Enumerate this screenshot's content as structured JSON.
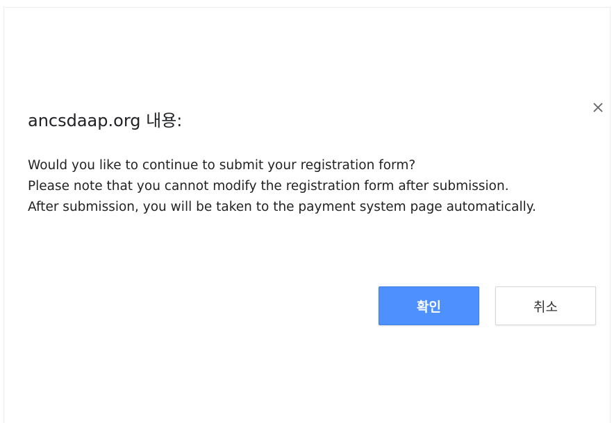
{
  "dialog": {
    "title": "ancsdaap.org 내용:",
    "message_lines": [
      "Would you like to continue to submit your registration form?",
      "Please note that you cannot modify the registration form after submission.",
      "After submission, you will be taken to the payment system page automatically."
    ],
    "ok_label": "확인",
    "cancel_label": "취소",
    "close_icon": "close-icon"
  },
  "colors": {
    "ok_button": "#4d90fe",
    "ok_text": "#ffffff",
    "cancel_border": "#d6d6d6"
  }
}
